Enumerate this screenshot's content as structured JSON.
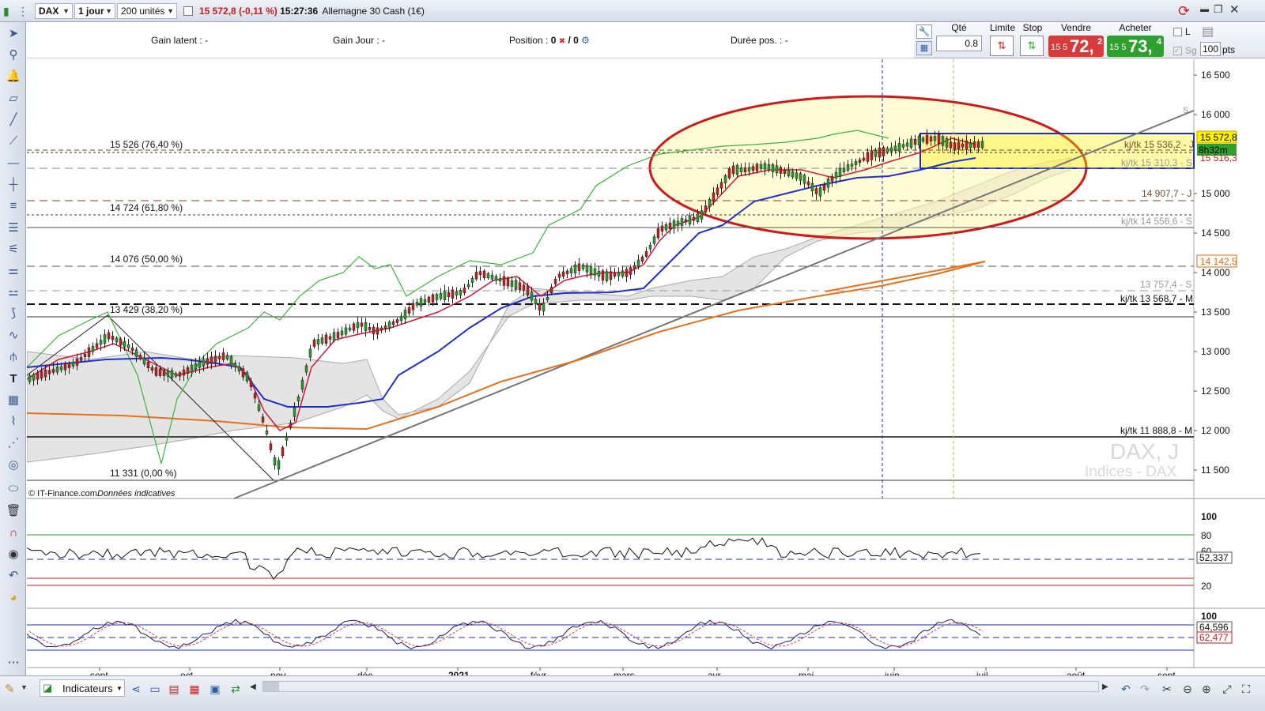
{
  "toolbar": {
    "symbol": "DAX",
    "period": "1 jour",
    "units": "200 unités",
    "quote_price": "15 572,8",
    "quote_change": "(-0,11 %)",
    "quote_time": "15:27:36",
    "instrument": "Allemagne 30 Cash (1€)"
  },
  "info": {
    "gain_latent_label": "Gain latent :",
    "gain_latent_value": "-",
    "gain_jour_label": "Gain Jour :",
    "gain_jour_value": "-",
    "position_label": "Position :",
    "position_value": "0",
    "position_sep": "/ 0",
    "duree_label": "Durée pos. :",
    "duree_value": "-"
  },
  "order": {
    "qty_label": "Qté",
    "qty_value": "0.8",
    "limit_label": "Limite",
    "stop_label": "Stop",
    "sell_label": "Vendre",
    "sell_small": "15 5",
    "sell_big": "72,",
    "sell_sup": "2",
    "buy_label": "Acheter",
    "buy_small": "15 5",
    "buy_big": "73,",
    "buy_sup": "4",
    "l_label": "L",
    "sg_label": "Sg",
    "pts_value": "100",
    "pts_label": "pts",
    "sell_color": "#d93a3a",
    "buy_color": "#2ea02e"
  },
  "chart": {
    "watermark_title": "DAX, J",
    "watermark_sub": "Indices - DAX",
    "credit": "© IT-Finance.com",
    "credit_note": "Données indicatives",
    "price_axis": [
      "16 500",
      "16 000",
      "15 000",
      "14 500",
      "14 000",
      "13 500",
      "13 000",
      "12 500",
      "12 000",
      "11 500"
    ],
    "current_price_tag": "15 572,8",
    "countdown_tag": "8h32m",
    "price_tag_2": "15 516,3",
    "orange_tag": "14 142,5",
    "fib_labels": [
      "15 526 (76,40 %)",
      "14 724 (61,80 %)",
      "14 076 (50,00 %)",
      "13 429 (38,20 %)",
      "11 331 (0,00 %)"
    ],
    "level_labels": [
      "kj/tk 15 536,2 - J",
      "kj/tk 15 310,3 - S",
      "14 907,7 - J",
      "kj/tk 14 556,6 - S",
      "14 142,5",
      "13 757,4 - S",
      "kj/tk 13 568,7 - M",
      "kj/tk 11 888,8 - M"
    ],
    "s_marker": "S",
    "x_labels": [
      "sept.",
      "oct.",
      "nov.",
      "déc.",
      "2021",
      "févr.",
      "mars",
      "avr.",
      "mai",
      "juin",
      "juil.",
      "août",
      "sept."
    ],
    "rsi_axis": [
      "100",
      "80",
      "60",
      "20"
    ],
    "rsi_tag": "52,337",
    "stoch_axis": [
      "100"
    ],
    "stoch_tag_1": "64,596",
    "stoch_tag_2": "62,477",
    "colors": {
      "tenkan": "#d4143a",
      "kijun": "#2030c8",
      "chikou": "#3ab43a",
      "ma": "#e8701a",
      "ellipse": "#d01818",
      "zone": "#fff8b0"
    }
  },
  "bottombar": {
    "indicators_label": "Indicateurs"
  }
}
